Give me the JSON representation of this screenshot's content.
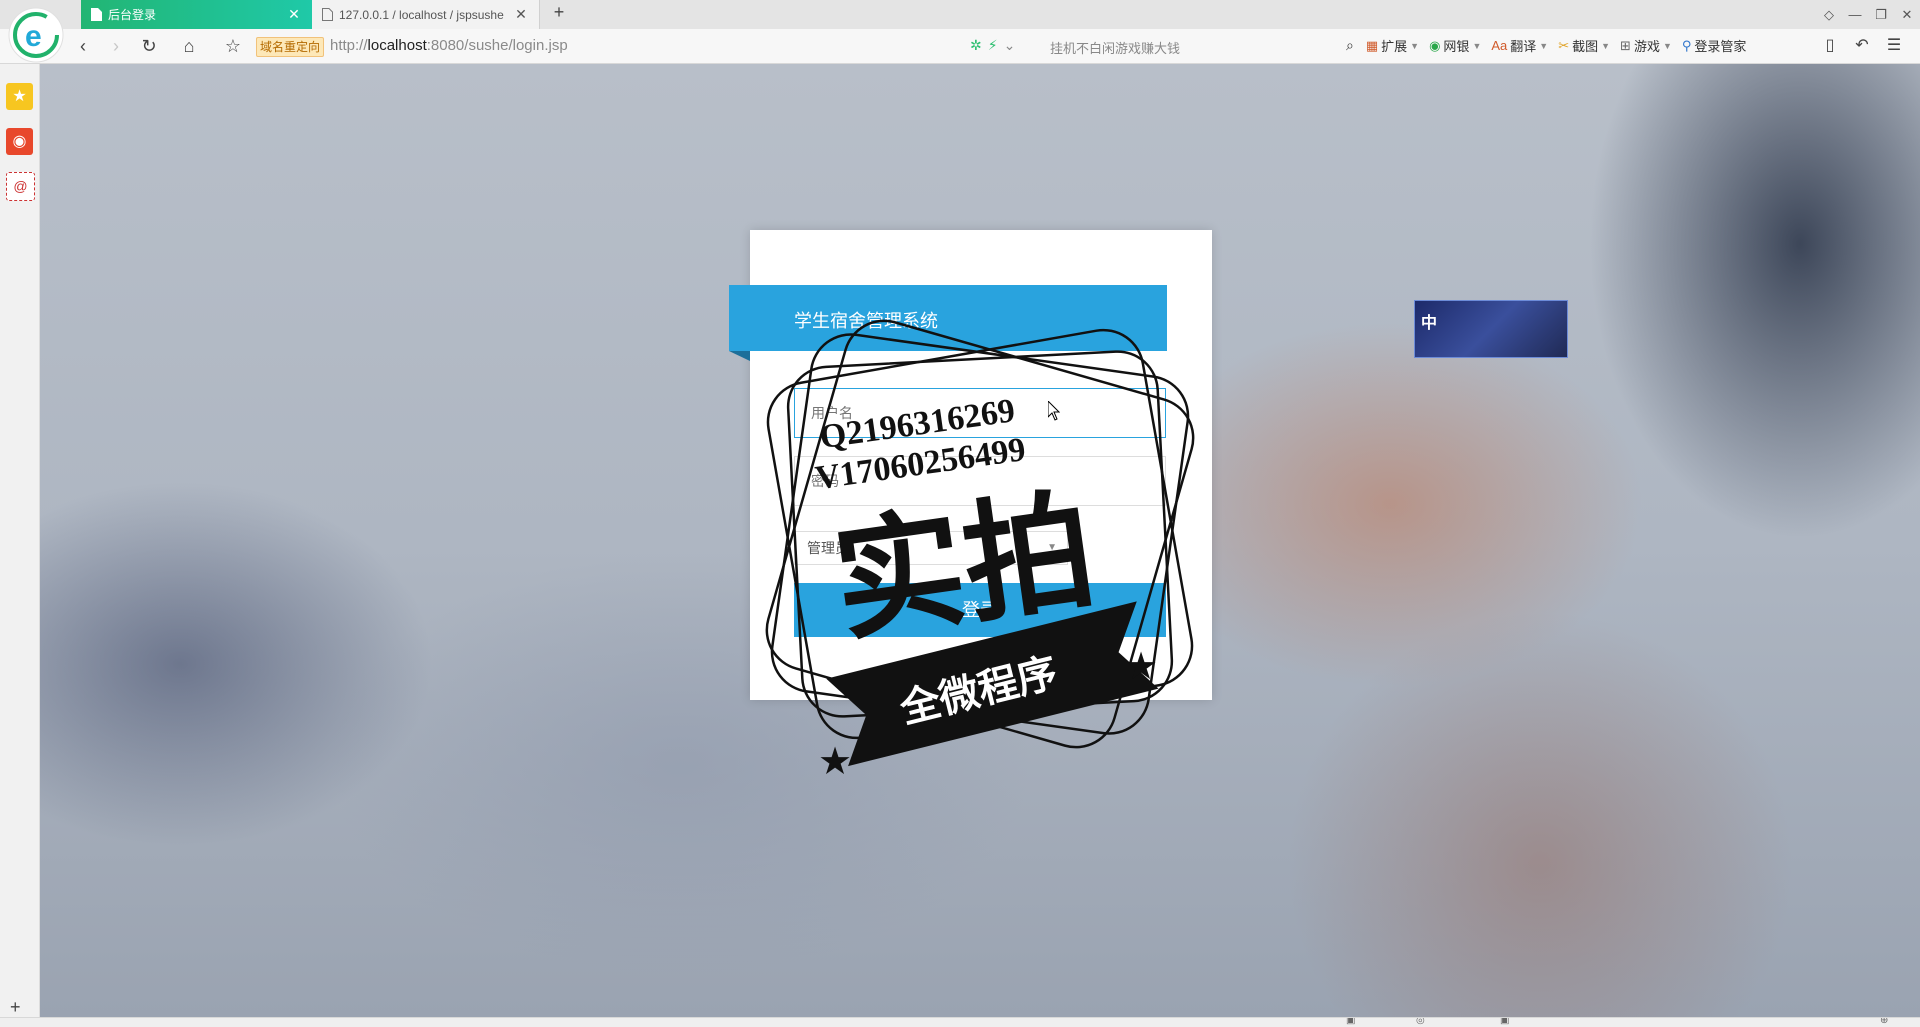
{
  "browser": {
    "tabs": [
      {
        "label": "后台登录",
        "active": true
      },
      {
        "label": "127.0.0.1 / localhost / jspsushe",
        "active": false
      }
    ],
    "new_tab_symbol": "+",
    "redirect_badge": "域名重定向",
    "url_host": "http://localhost",
    "url_path": ":8080/sushe/login.jsp",
    "search_hint": "挂机不白闲游戏赚大钱",
    "toolbar_items": [
      {
        "label": "扩展",
        "icon": "extension-icon"
      },
      {
        "label": "网银",
        "icon": "shield-icon"
      },
      {
        "label": "翻译",
        "icon": "translate-icon"
      },
      {
        "label": "截图",
        "icon": "screenshot-icon"
      },
      {
        "label": "游戏",
        "icon": "game-icon"
      },
      {
        "label": "登录管家",
        "icon": "key-icon"
      }
    ]
  },
  "login": {
    "system_title": "学生宿舍管理系统",
    "username_placeholder": "用户名",
    "password_placeholder": "密码",
    "role_selected": "管理员",
    "submit_label": "登录"
  },
  "watermark": {
    "line1": "Q2196316269",
    "line2": "V17060256499",
    "big_text": "实拍",
    "ribbon_text": "全微程序"
  },
  "float_widget": {
    "label": "中"
  },
  "colors": {
    "accent_blue": "#29a3de",
    "tab_active": "#22b573",
    "redirect_bg": "#fde8b8"
  }
}
